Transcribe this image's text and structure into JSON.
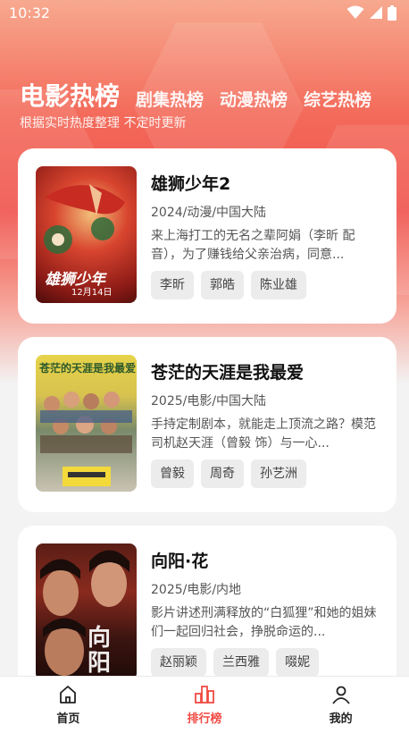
{
  "status_bar": {
    "time": "10:32"
  },
  "tabs": [
    {
      "label": "电影热榜",
      "active": true
    },
    {
      "label": "剧集热榜",
      "active": false
    },
    {
      "label": "动漫热榜",
      "active": false
    },
    {
      "label": "综艺热榜",
      "active": false
    }
  ],
  "subtitle": "根据实时热度整理 不定时更新",
  "cards": [
    {
      "title": "雄狮少年2",
      "meta": "2024/动漫/中国大陆",
      "description": "来上海打工的无名之辈阿娟（李昕 配音），为了赚钱给父亲治病，同意...",
      "cast": [
        "李昕",
        "郭皓",
        "陈业雄"
      ],
      "poster_caption": "12月14日",
      "poster_title": "雄狮少年"
    },
    {
      "title": "苍茫的天涯是我最爱",
      "meta": "2025/电影/中国大陆",
      "description": "手持定制剧本，就能走上顶流之路？模范司机赵天涯（曾毅 饰）与一心...",
      "cast": [
        "曾毅",
        "周奇",
        "孙艺洲"
      ],
      "poster_caption": "苍茫的天涯是我最爱"
    },
    {
      "title": "向阳·花",
      "meta": "2025/电影/内地",
      "description": "影片讲述刑满释放的“白狐狸”和她的姐妹们一起回归社会，挣脱命运的...",
      "cast": [
        "赵丽颖",
        "兰西雅",
        "啜妮"
      ],
      "poster_caption": "向阳"
    }
  ],
  "nav": [
    {
      "label": "首页",
      "icon": "home-icon",
      "active": false
    },
    {
      "label": "排行榜",
      "icon": "ranking-icon",
      "active": true
    },
    {
      "label": "我的",
      "icon": "user-icon",
      "active": false
    }
  ],
  "colors": {
    "accent": "#f04a43",
    "hero_top": "#f7a98f",
    "hero_mid": "#f0524c"
  }
}
